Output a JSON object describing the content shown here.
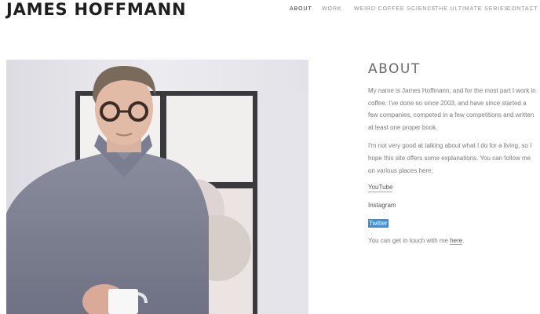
{
  "site": {
    "title": "JAMES HOFFMANN"
  },
  "nav": [
    {
      "label": "ABOUT",
      "active": true
    },
    {
      "label": "WORK"
    },
    {
      "label": "WEIRD COFFEE SCIENCE"
    },
    {
      "label": "THE ULTIMATE SERIES"
    },
    {
      "label": "CONTACT"
    }
  ],
  "about": {
    "heading": "ABOUT",
    "para1": "My name is James Hoffmann, and for the most part I work in coffee. I've done so since 2003, and have since started a few companies, competed in a few competitions and written at least one proper book.",
    "para2": "I'm not very good at talking about what I do for a living, so I hope this site offers some explanations. You can follow me on various places here:",
    "links": [
      {
        "label": "YouTube"
      },
      {
        "label": "Instagram"
      },
      {
        "label": "Twitter",
        "selected": true
      }
    ],
    "contact_prefix": "You can get in touch with me",
    "contact_link": "here",
    "contact_suffix": "."
  },
  "colors": {
    "selection": "#3a8ee6",
    "title": "#1e1e1e",
    "nav": "#8d8d8d"
  }
}
